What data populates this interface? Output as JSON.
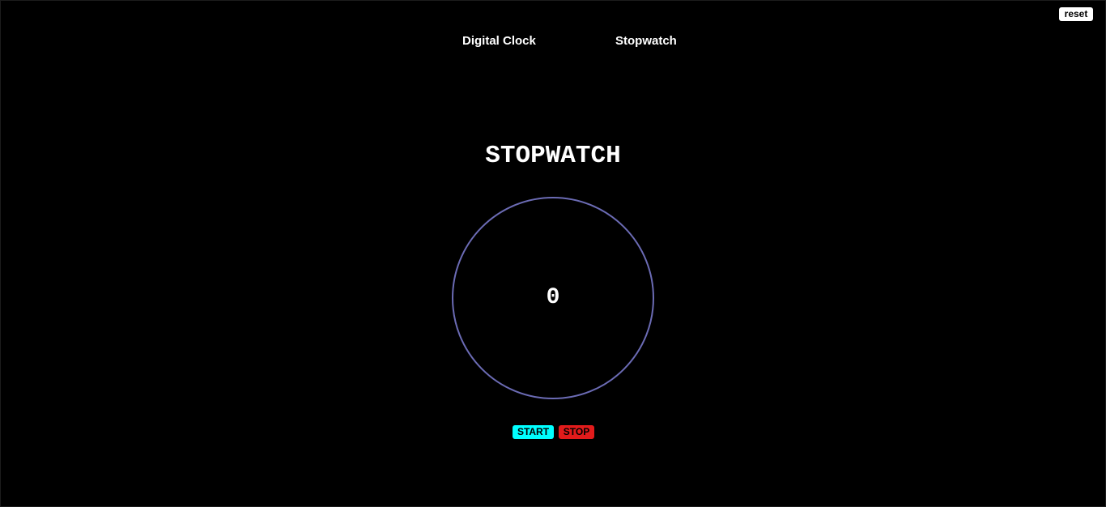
{
  "toolbar": {
    "reset_label": "reset"
  },
  "nav": {
    "items": [
      {
        "label": "Digital Clock"
      },
      {
        "label": "Stopwatch"
      }
    ]
  },
  "stopwatch": {
    "title": "STOPWATCH",
    "count": "0",
    "start_label": "START",
    "stop_label": "STOP"
  },
  "colors": {
    "background": "#000000",
    "ring": "#6b6bb4",
    "start": "#00ffff",
    "stop": "#e21b1b",
    "text": "#ffffff"
  }
}
